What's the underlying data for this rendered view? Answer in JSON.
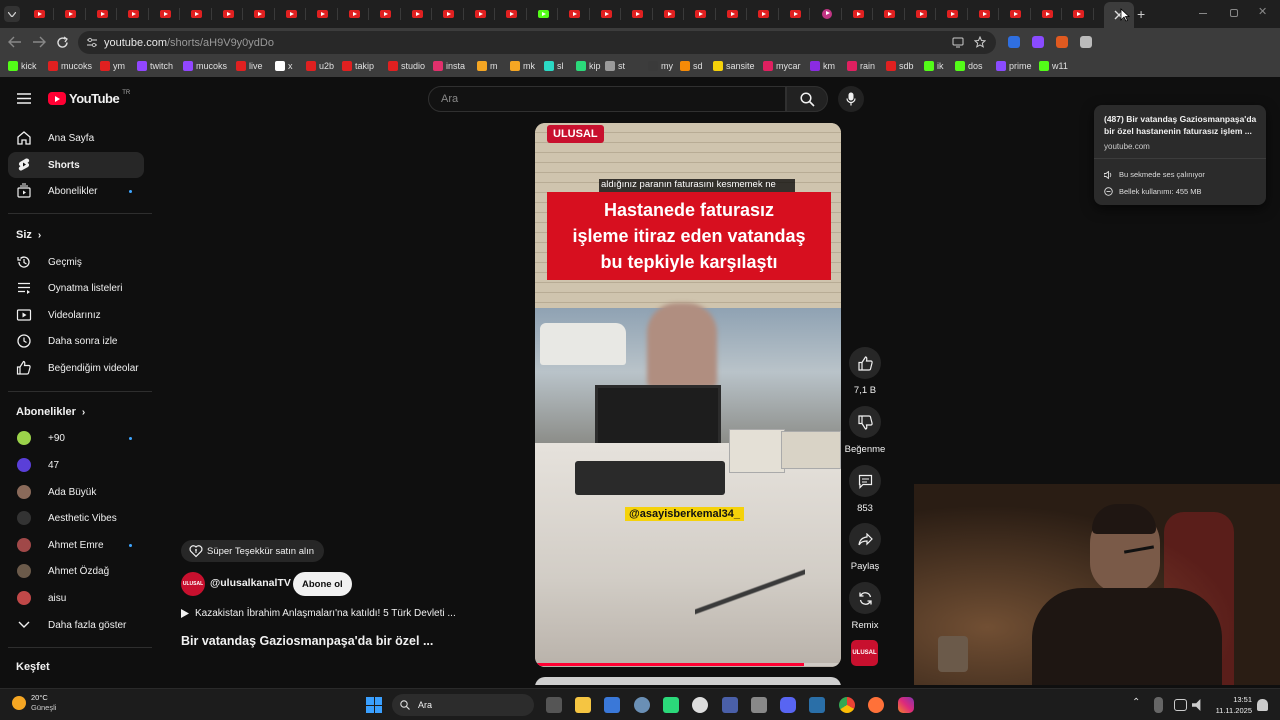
{
  "browser": {
    "url_host": "youtube.com",
    "url_path": "/shorts/aH9V9y0ydDo",
    "new_tab": "+",
    "bookmarks": [
      {
        "label": "kick",
        "color": "#53fc18"
      },
      {
        "label": "mucoks",
        "color": "#e02020"
      },
      {
        "label": "ym",
        "color": "#e02020"
      },
      {
        "label": "twitch",
        "color": "#9146ff"
      },
      {
        "label": "mucoks",
        "color": "#9146ff"
      },
      {
        "label": "live",
        "color": "#e02020"
      },
      {
        "label": "x",
        "color": "#ffffff"
      },
      {
        "label": "u2b",
        "color": "#e02020"
      },
      {
        "label": "takip",
        "color": "#e02020"
      },
      {
        "label": "studio",
        "color": "#e02020"
      },
      {
        "label": "insta",
        "color": "#e1306c"
      },
      {
        "label": "m",
        "color": "#f5a623"
      },
      {
        "label": "mk",
        "color": "#f5a623"
      },
      {
        "label": "sl",
        "color": "#2bd9c4"
      },
      {
        "label": "kip",
        "color": "#2bd97a"
      },
      {
        "label": "st",
        "color": "#9a9a9a"
      },
      {
        "label": "my",
        "color": "#3a3a3a"
      },
      {
        "label": "sd",
        "color": "#f58a07"
      },
      {
        "label": "sansite",
        "color": "#f5d20a"
      },
      {
        "label": "mycar",
        "color": "#e02060"
      },
      {
        "label": "km",
        "color": "#8a2be2"
      },
      {
        "label": "rain",
        "color": "#e02060"
      },
      {
        "label": "sdb",
        "color": "#e02020"
      },
      {
        "label": "ik",
        "color": "#53fc18"
      },
      {
        "label": "dos",
        "color": "#53fc18"
      },
      {
        "label": "prime",
        "color": "#8a4bff"
      },
      {
        "label": "w11",
        "color": "#53fc18"
      }
    ]
  },
  "tooltip": {
    "title": "(487) Bir vatandaş Gaziosmanpaşa'da bir özel hastanenin faturasız işlem ...",
    "domain": "youtube.com",
    "audio": "Bu sekmede ses çalınıyor",
    "memory": "Bellek kullanımı: 455 MB"
  },
  "youtube": {
    "logo": "YouTube",
    "country": "TR",
    "search_placeholder": "Ara",
    "nav": [
      {
        "label": "Ana Sayfa",
        "icon": "home-icon"
      },
      {
        "label": "Shorts",
        "icon": "shorts-icon"
      },
      {
        "label": "Abonelikler",
        "icon": "subscriptions-icon"
      }
    ],
    "you_header": "Siz",
    "you_items": [
      {
        "label": "Geçmiş",
        "icon": "history-icon"
      },
      {
        "label": "Oynatma listeleri",
        "icon": "playlist-icon"
      },
      {
        "label": "Videolarınız",
        "icon": "your-videos-icon"
      },
      {
        "label": "Daha sonra izle",
        "icon": "watch-later-icon"
      },
      {
        "label": "Beğendiğim videolar",
        "icon": "liked-icon"
      }
    ],
    "subs_header": "Abonelikler",
    "subs": [
      {
        "label": "+90",
        "color": "#9bd34a"
      },
      {
        "label": "47",
        "color": "#5a3fd8"
      },
      {
        "label": "Ada Büyük",
        "color": "#8a6a5a"
      },
      {
        "label": "Aesthetic Vibes",
        "color": "#333333"
      },
      {
        "label": "Ahmet Emre",
        "color": "#a04848"
      },
      {
        "label": "Ahmet Özdağ",
        "color": "#6b5a4a"
      },
      {
        "label": "aisu",
        "color": "#c04848"
      }
    ],
    "show_more": "Daha fazla göster",
    "explore_header": "Keşfet",
    "super_thanks": "Süper Teşekkür satın alın",
    "channel": "@ulusalkanalTV",
    "subscribe": "Abone ol",
    "description": "Kazakistan İbrahim Anlaşmaları'na katıldı! 5 Türk Devleti ...",
    "video_title": "Bir vatandaş Gaziosmanpaşa'da bir özel ...",
    "actions": {
      "likes": "7,1 B",
      "dislike": "Beğenme",
      "comments": "853",
      "share": "Paylaş",
      "remix": "Remix"
    }
  },
  "video": {
    "brand": "ULUSAL",
    "caption": "aldığınız paranın faturasını kesmemek ne demek? Aldığınız.",
    "headline": [
      "Hastanede faturasız",
      "işleme itiraz eden vatandaş",
      "bu tepkiyle karşılaştı"
    ],
    "watermark": "@asayisberkemal34_",
    "progress": 0.88
  },
  "taskbar": {
    "weather_temp": "20°C",
    "weather_label": "Güneşli",
    "search": "Ara",
    "time": "13:51",
    "date": "11.11.2025"
  }
}
